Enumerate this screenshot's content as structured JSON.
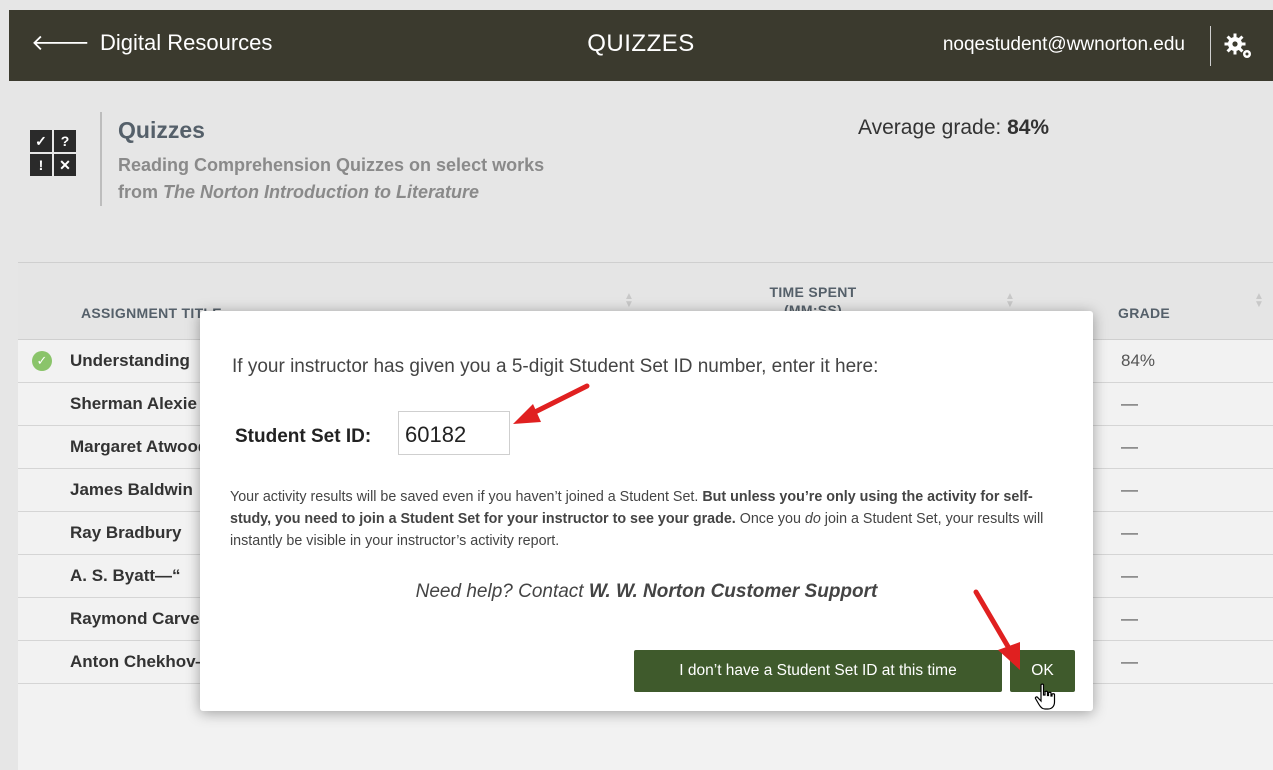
{
  "topbar": {
    "back_label": "Digital Resources",
    "title": "QUIZZES",
    "user_email": "noqestudent@wwnorton.edu",
    "bg_color": "#3b3a2e"
  },
  "header": {
    "icon_glyphs": [
      "✓",
      "?",
      "!",
      "✕"
    ],
    "title": "Quizzes",
    "subtitle_line1": "Reading Comprehension Quizzes on select works",
    "subtitle_line2_prefix": "from ",
    "subtitle_line2_italic": "The Norton Introduction to Literature",
    "average_label": "Average grade: ",
    "average_value": "84%"
  },
  "table": {
    "col_title": "ASSIGNMENT TITLE",
    "col_time_line1": "TIME SPENT",
    "col_time_line2": "(MM:SS)",
    "col_grade": "GRADE",
    "rows": [
      {
        "title": "Understanding",
        "time": "",
        "grade": "84%",
        "completed": true
      },
      {
        "title": "Sherman Alexie",
        "time": "",
        "grade": "—",
        "completed": false
      },
      {
        "title": "Margaret Atwood",
        "time": "",
        "grade": "—",
        "completed": false
      },
      {
        "title": "James Baldwin",
        "time": "",
        "grade": "—",
        "completed": false
      },
      {
        "title": "Ray Bradbury",
        "time": "",
        "grade": "—",
        "completed": false
      },
      {
        "title": "A. S. Byatt—“",
        "time": "",
        "grade": "—",
        "completed": false
      },
      {
        "title": "Raymond Carver",
        "time": "",
        "grade": "—",
        "completed": false
      },
      {
        "title": "Anton Chekhov—“The Lady with the Dog”",
        "time": "—",
        "grade": "—",
        "completed": false
      }
    ]
  },
  "modal": {
    "prompt": "If your instructor has given you a 5-digit Student Set ID number, enter it here:",
    "id_label": "Student Set ID:",
    "id_value": "60182",
    "info_part1": "Your activity results will be saved even if you haven’t joined a Student Set. ",
    "info_bold": "But unless you’re only using the activity for self-study, you need to join a Student Set for your instructor to see your grade.",
    "info_part2_prefix": " Once you ",
    "info_part2_italic": "do",
    "info_part2_suffix": " join a Student Set, your results will instantly be visible in your instructor’s activity report.",
    "help_prefix": "Need help? Contact ",
    "help_link": "W. W. Norton Customer Support",
    "no_id_button": "I don’t have a Student Set ID at this time",
    "ok_button": "OK",
    "button_color": "#3f5a2c",
    "annotation_color": "#e02020"
  }
}
